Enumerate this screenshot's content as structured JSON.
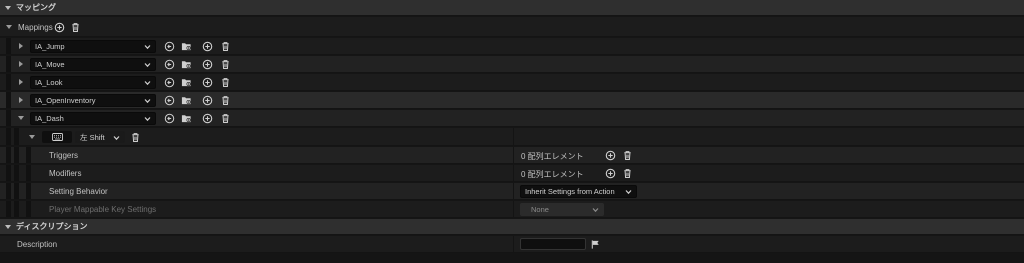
{
  "section_mapping": {
    "title": "マッピング"
  },
  "mappings": {
    "label": "Mappings",
    "actions": [
      "IA_Jump",
      "IA_Move",
      "IA_Look",
      "IA_OpenInventory",
      "IA_Dash"
    ]
  },
  "dash_key": {
    "key_label": "左 Shift",
    "properties": {
      "triggers": {
        "label": "Triggers",
        "value": "0 配列エレメント"
      },
      "modifiers": {
        "label": "Modifiers",
        "value": "0 配列エレメント"
      },
      "setting_behavior": {
        "label": "Setting Behavior",
        "value": "Inherit Settings from Action"
      },
      "player_mappable": {
        "label": "Player Mappable Key Settings",
        "value": "None"
      }
    }
  },
  "section_description": {
    "title": "ディスクリプション",
    "description_label": "Description",
    "description_value": ""
  }
}
